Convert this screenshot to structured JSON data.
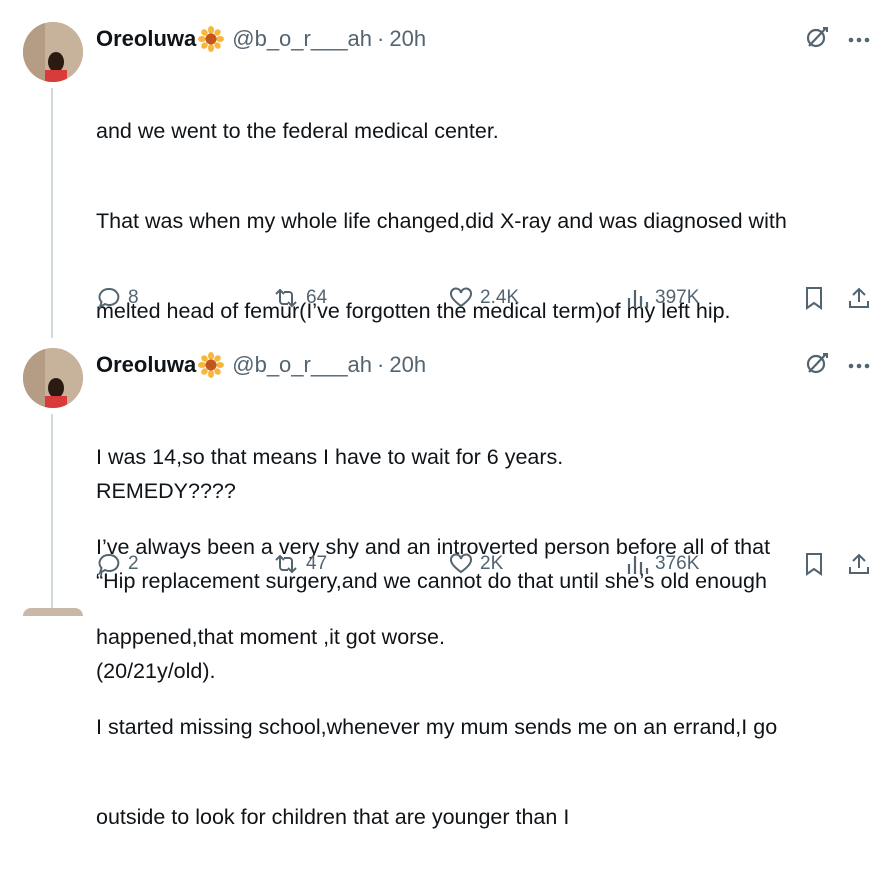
{
  "tweets": [
    {
      "author": {
        "name": "Oreoluwa",
        "handle": "@b_o_r___ah",
        "time": "20h"
      },
      "lines": [
        "and we went to the federal medical center.",
        "That was when my whole life changed,did X-ray and was diagnosed with",
        "melted head of femur(I’ve forgotten the medical term)of my left hip.",
        "",
        "REMEDY????",
        "“Hip replacement surgery,and we cannot do that until she’s old enough",
        "(20/21y/old)."
      ],
      "stats": {
        "replies": "8",
        "reposts": "64",
        "likes": "2.4K",
        "views": "397K"
      }
    },
    {
      "author": {
        "name": "Oreoluwa",
        "handle": "@b_o_r___ah",
        "time": "20h"
      },
      "lines": [
        "I was 14,so that means I have to wait for 6 years.",
        "I’ve always been a very shy and an introverted person before all of that",
        "happened,that moment ,it got worse.",
        "I started missing school,whenever my mum sends me on an errand,I go",
        "outside to look for children that are younger than I"
      ],
      "stats": {
        "replies": "2",
        "reposts": "47",
        "likes": "2K",
        "views": "376K"
      }
    }
  ],
  "icons": {
    "grok": "grok-icon",
    "more": "more-icon",
    "reply": "reply-icon",
    "repost": "repost-icon",
    "like": "like-icon",
    "views": "views-icon",
    "bookmark": "bookmark-icon",
    "share": "share-icon",
    "flower": "sunflower-emoji"
  },
  "colors": {
    "text": "#0f1419",
    "secondary": "#536471",
    "thread": "#cfd9de"
  }
}
